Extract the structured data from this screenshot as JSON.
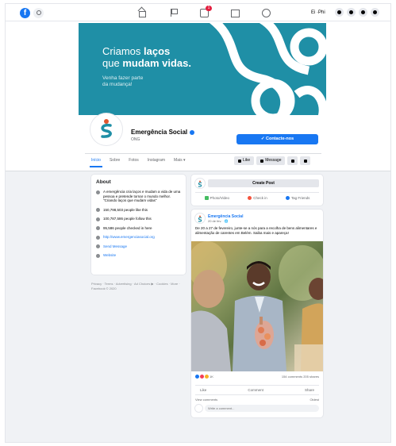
{
  "nav": {
    "logo": "f",
    "user_name": "Ei ·Phi",
    "notification_count": "1"
  },
  "cover": {
    "line1_a": "Criamos ",
    "line1_b": "laços",
    "line2_a": "que ",
    "line2_b": "mudam vidas.",
    "subtitle": "Venha fazer parte da mudança!",
    "colors": {
      "background": "#1f8fa6",
      "shape": "#ffffff"
    }
  },
  "page": {
    "name": "Emergência Social",
    "category": "ONG",
    "contact_button": "✓ Contacte-nos"
  },
  "tabs": [
    "Início",
    "Sobre",
    "Fotos",
    "Instagram",
    "Mais ▾"
  ],
  "actions": {
    "like": "Like",
    "message": "Message"
  },
  "about": {
    "title": "About",
    "description": "A emergência cria laços e mudam a vida de uma pessoa e pretende tornar o mundo melhor. \"Criando laços que mudam vidas\"",
    "likes": "150,798,503 people like this",
    "follows": "100,787,586 people follow this",
    "checked_in": "95,586 people checked in here",
    "website": "http://www.emergenciasocial.org",
    "send_message": "Send Message",
    "category": "Website"
  },
  "footer": "Privacy · Terms · Advertising · Ad Choices ▶ · Cookies · More · Facebook © 2020",
  "create_post": {
    "button": "Create Post",
    "photo_video": "Photo/Video",
    "check_in": "Check in",
    "tag_friends": "Tag Friends"
  },
  "post": {
    "author": "Emergência Social",
    "time": "20 de fev. · 🌐",
    "text": "De 20 a 27 de fevereiro, junte-se a nós para a recolha de bens alimentares e alimentação de carentes em Belém. Saiba mais e apareça!",
    "reaction_count": "1K",
    "comments_shares": "154 comments 205 shares",
    "like": "Like",
    "comment": "Comment",
    "share": "Share",
    "view_comments": "View comments",
    "oldest": "Oldest",
    "write_comment": "Write a comment..."
  }
}
